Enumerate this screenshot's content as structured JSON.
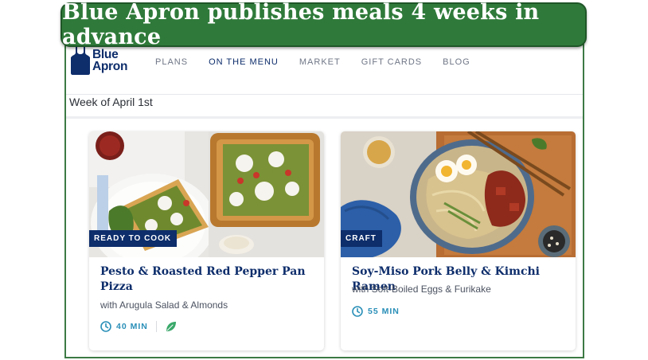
{
  "banner": {
    "text": "Blue Apron publishes meals 4 weeks in advance"
  },
  "logo": {
    "line1": "Blue",
    "line2": "Apron"
  },
  "nav": {
    "items": [
      {
        "label": "PLANS",
        "active": false
      },
      {
        "label": "ON THE MENU",
        "active": true
      },
      {
        "label": "MARKET",
        "active": false
      },
      {
        "label": "GIFT CARDS",
        "active": false
      },
      {
        "label": "BLOG",
        "active": false
      }
    ]
  },
  "week": {
    "label": "Week of April 1st"
  },
  "cards": [
    {
      "tag": "READY TO COOK",
      "title": "Pesto & Roasted Red Pepper Pan Pizza",
      "subtitle": "with Arugula Salad & Almonds",
      "time": "40 MIN",
      "icons": [
        "clock-icon",
        "leaf-icon"
      ]
    },
    {
      "tag": "CRAFT",
      "title": "Soy-Miso Pork Belly & Kimchi Ramen",
      "subtitle": "with Soft-Boiled Eggs & Furikake",
      "time": "55 MIN",
      "icons": [
        "clock-icon"
      ]
    }
  ],
  "colors": {
    "brand_navy": "#0d2d6b",
    "banner_green": "#2f7a3a",
    "time_blue": "#2a8fb8",
    "leaf_green": "#3aa86a"
  }
}
